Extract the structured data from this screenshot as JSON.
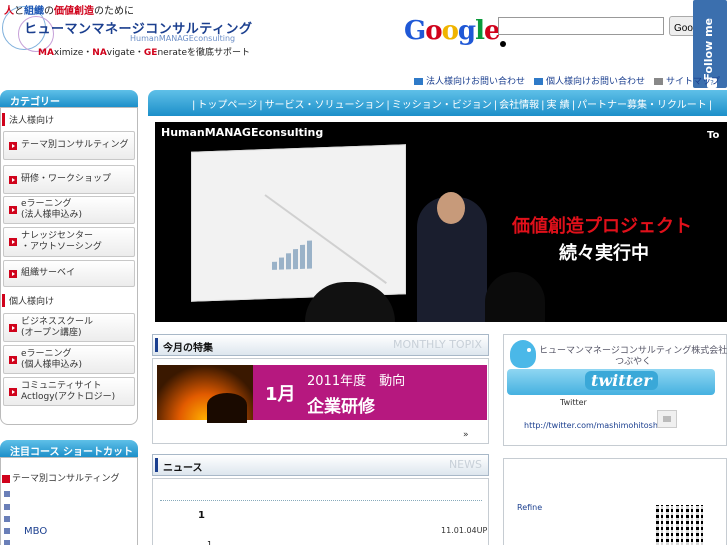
{
  "header": {
    "tagline_prefix": "人",
    "tagline_mid1": "と",
    "tagline_org": "組織",
    "tagline_mid2": "の",
    "tagline_value": "価値創造",
    "tagline_suffix": "のために",
    "company_jp": "ヒューマンマネージコンサルティング",
    "company_en": "HumanMANAGEconsulting",
    "slogan_ma": "MA",
    "slogan_ximize": "ximize・",
    "slogan_na": "NA",
    "slogan_vigate": "vigate・",
    "slogan_ge": "GE",
    "slogan_rest": "nerateを徹底サポート"
  },
  "search": {
    "google_letters": [
      "G",
      "o",
      "o",
      "g",
      "l",
      "e"
    ],
    "google_colors": [
      "#1f58d6",
      "#d0021b",
      "#f0b400",
      "#1f58d6",
      "#0a9a3b",
      "#d0021b"
    ],
    "input_value": "",
    "button_label": "Google 検索"
  },
  "follow": {
    "label": "Follow me",
    "badge": "?"
  },
  "toplinks": {
    "corporate_inquiry": "法人様向けお問い合わせ",
    "personal_inquiry": "個人様向けお問い合わせ",
    "sitemap": "サイトマップ"
  },
  "nav": {
    "items": [
      "トップページ",
      "サービス・ソリューション",
      "ミッション・ビジョン",
      "会社情報",
      "実 績",
      "パートナー募集・リクルート"
    ]
  },
  "sidebar": {
    "category_title": "カテゴリー",
    "corporate_label": "法人様向け",
    "corporate_items": [
      "テーマ別コンサルティング",
      "研修・ワークショップ",
      "eラーニング\n(法人様申込み)",
      "ナレッジセンター\n・アウトソーシング",
      "組織サーベイ"
    ],
    "personal_label": "個人様向け",
    "personal_items": [
      "ビジネススクール\n(オープン講座)",
      "eラーニング\n(個人様申込み)",
      "コミュニティサイト\nActlogy(アクトロジー)"
    ],
    "shortcut_title": "注目コース ショートカット",
    "shortcut_first": "テーマ別コンサルティング",
    "shortcut_mbo": "MBO"
  },
  "hero": {
    "brand": "HumanMANAGEconsulting",
    "corner": "To",
    "headline_red": "価値創造プロジェクト",
    "headline_white": "続々実行中"
  },
  "monthly": {
    "title_jp": "今月の特集",
    "title_en": "MONTHLY TOPIX",
    "month": "1月",
    "line1": "2011年度　動向",
    "line2": "企業研修",
    "more": "»"
  },
  "news": {
    "title_jp": "ニュース",
    "title_en": "NEWS",
    "first_num": "1",
    "first_date": "11.01.04UP",
    "second_num": "1"
  },
  "twitter": {
    "company": "ヒューマンマネージコンサルティング株式会社",
    "subtitle": "つぶやく",
    "logo_text": "twitter",
    "label": "Twitter",
    "url": "http://twitter.com/mashimohitoshi",
    "refine": "Refine"
  }
}
